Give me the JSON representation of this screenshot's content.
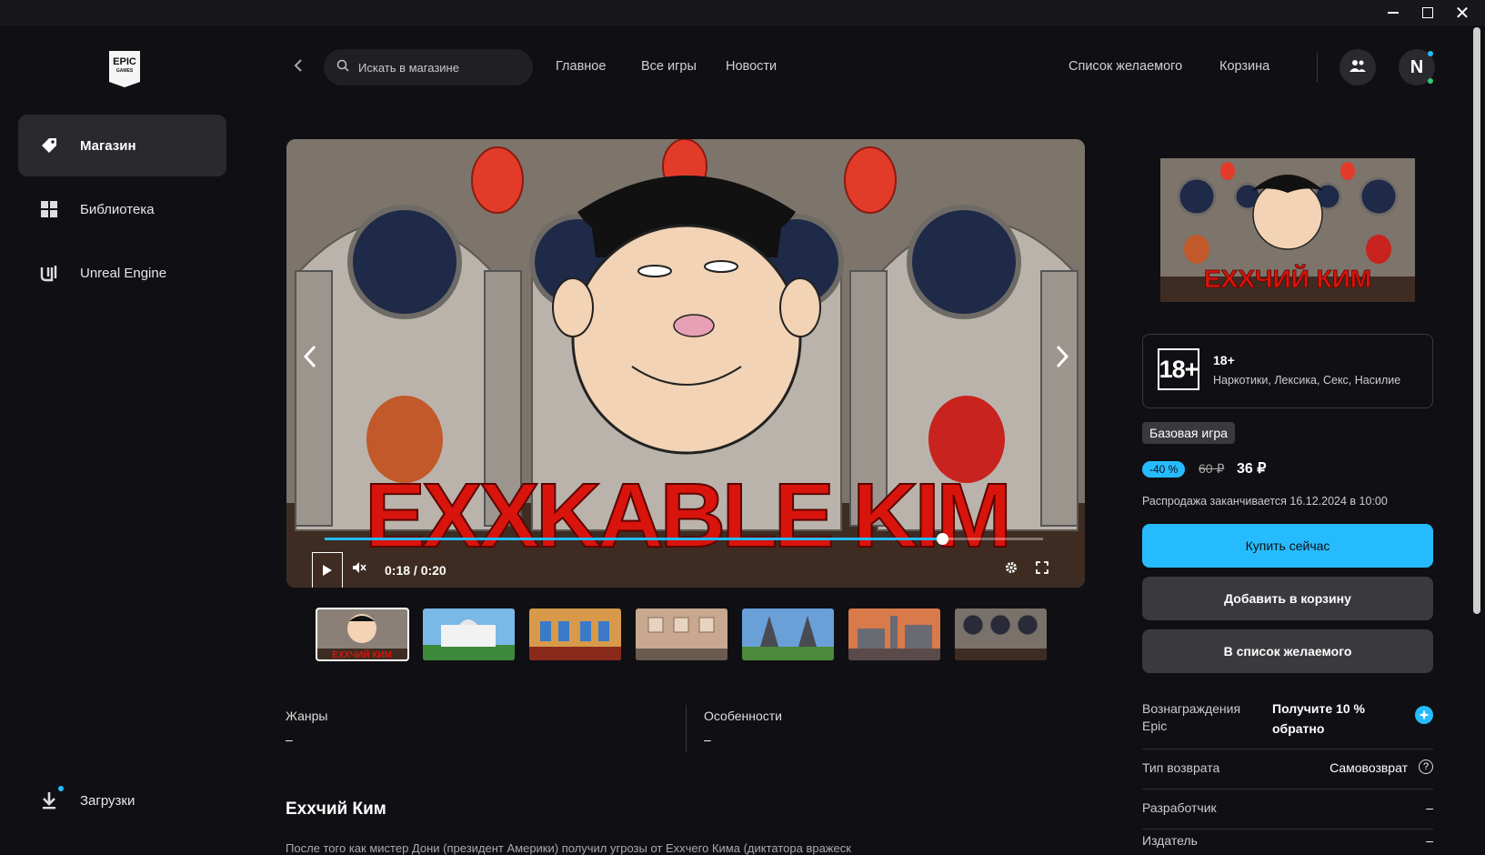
{
  "window": {
    "minimize": "—",
    "maximize": "☐",
    "close": "✕"
  },
  "logo": {
    "line1": "EPIC",
    "line2": "GAMES"
  },
  "sidebar": {
    "items": [
      {
        "label": "Магазин",
        "icon": "tag-icon"
      },
      {
        "label": "Библиотека",
        "icon": "grid-icon"
      },
      {
        "label": "Unreal Engine",
        "icon": "unreal-icon"
      }
    ],
    "downloads": "Загрузки"
  },
  "topbar": {
    "search_placeholder": "Искать в магазине",
    "links": [
      "Главное",
      "Все игры",
      "Новости"
    ],
    "wishlist": "Список желаемого",
    "cart": "Корзина",
    "avatar_letter": "N"
  },
  "media": {
    "banner_text": "EXXKABLE KIM",
    "time": "0:18 / 0:20",
    "progress": 0.86
  },
  "thumbnails": [
    {
      "label": "ЕХХЧИЙ КИМ",
      "active": true
    },
    {
      "label": "",
      "active": false
    },
    {
      "label": "",
      "active": false
    },
    {
      "label": "",
      "active": false
    },
    {
      "label": "",
      "active": false
    },
    {
      "label": "",
      "active": false
    },
    {
      "label": "",
      "active": false
    }
  ],
  "details": {
    "genres_label": "Жанры",
    "genres_value": "–",
    "features_label": "Особенности",
    "features_value": "–",
    "title": "Ехxчий Ким",
    "description": "После того как мистер Дони (президент Америки) получил угрозы от Ехxчего Кима (диктатора вражеск"
  },
  "cover": {
    "banner_text": "ЕХХЧИЙ КИМ"
  },
  "purchase": {
    "rating_badge": "18+",
    "rating_title": "18+",
    "rating_desc": "Наркотики, Лексика, Секс, Насилие",
    "base_tag": "Базовая игра",
    "discount": "-40 %",
    "old_price": "60 ₽",
    "new_price": "36 ₽",
    "sale_ends": "Распродажа заканчивается 16.12.2024 в 10:00",
    "buy": "Купить сейчас",
    "add_to_cart": "Добавить в корзину",
    "wishlist": "В список желаемого",
    "rewards_label": "Вознаграждения Epic",
    "rewards_value": "Получите 10 % обратно",
    "refund_label": "Тип возврата",
    "refund_value": "Самовозврат",
    "developer_label": "Разработчик",
    "developer_value": "–",
    "publisher_label": "Издатель",
    "publisher_value": "–"
  },
  "colors": {
    "accent": "#26bbff",
    "bg": "#101014",
    "surface": "#2a2a2e"
  }
}
